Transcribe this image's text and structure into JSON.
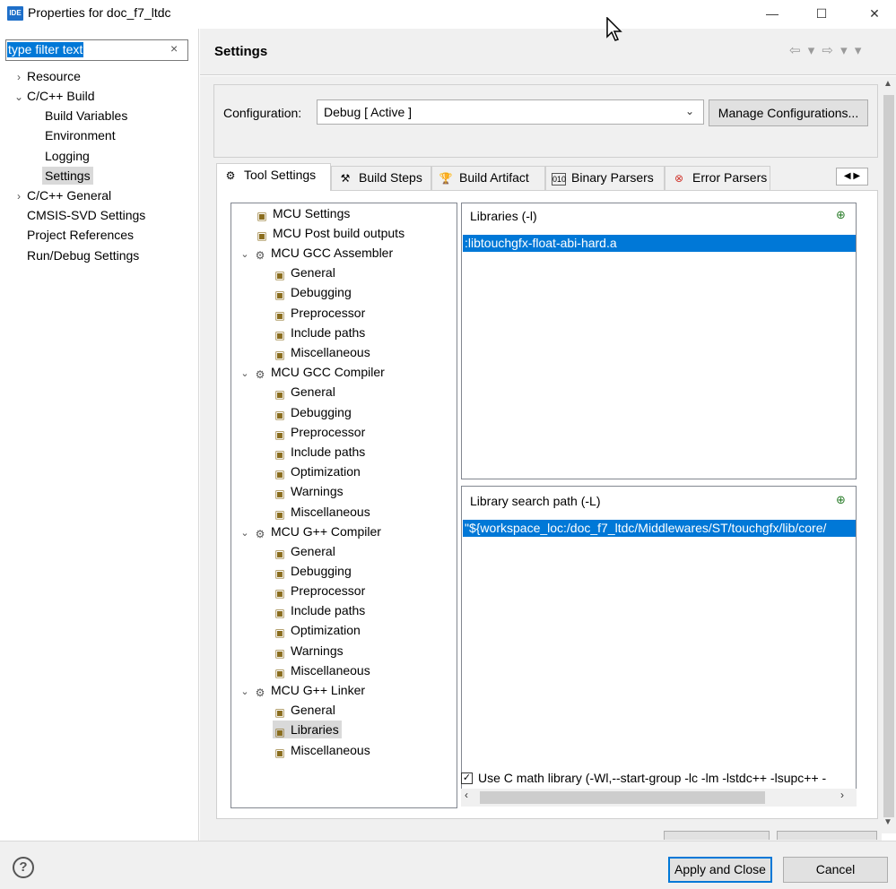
{
  "window": {
    "icon_text": "IDE",
    "title": "Properties for doc_f7_ltdc",
    "minimize": "—",
    "maximize": "☐",
    "close": "✕"
  },
  "filter": {
    "placeholder": "type filter text",
    "clear": "×"
  },
  "nav": [
    {
      "label": "Resource",
      "twisty": "›"
    },
    {
      "label": "C/C++ Build",
      "twisty": "⌄"
    },
    {
      "label": "Build Variables"
    },
    {
      "label": "Environment"
    },
    {
      "label": "Logging"
    },
    {
      "label": "Settings",
      "selected": true
    },
    {
      "label": "C/C++ General",
      "twisty": "›"
    },
    {
      "label": "CMSIS-SVD Settings"
    },
    {
      "label": "Project References"
    },
    {
      "label": "Run/Debug Settings"
    }
  ],
  "header": {
    "title": "Settings",
    "nav_arrows": "⇦ ▾ ⇨ ▾ ▾"
  },
  "configuration": {
    "label": "Configuration:",
    "value": "Debug  [ Active ]",
    "manage_button": "Manage Configurations..."
  },
  "tabs": [
    {
      "label": "Tool Settings",
      "icon": "gear-icon",
      "active": true
    },
    {
      "label": "Build Steps",
      "icon": "hammer-icon"
    },
    {
      "label": "Build Artifact",
      "icon": "trophy-icon"
    },
    {
      "label": "Binary Parsers",
      "icon": "binary-icon"
    },
    {
      "label": "Error Parsers",
      "icon": "error-icon"
    }
  ],
  "tree": [
    {
      "label": "MCU Settings",
      "level": 1
    },
    {
      "label": "MCU Post build outputs",
      "level": 1
    },
    {
      "label": "MCU GCC Assembler",
      "level": 0,
      "twisty": true
    },
    {
      "label": "General",
      "level": 2
    },
    {
      "label": "Debugging",
      "level": 2
    },
    {
      "label": "Preprocessor",
      "level": 2
    },
    {
      "label": "Include paths",
      "level": 2
    },
    {
      "label": "Miscellaneous",
      "level": 2
    },
    {
      "label": "MCU GCC Compiler",
      "level": 0,
      "twisty": true
    },
    {
      "label": "General",
      "level": 2
    },
    {
      "label": "Debugging",
      "level": 2
    },
    {
      "label": "Preprocessor",
      "level": 2
    },
    {
      "label": "Include paths",
      "level": 2
    },
    {
      "label": "Optimization",
      "level": 2
    },
    {
      "label": "Warnings",
      "level": 2
    },
    {
      "label": "Miscellaneous",
      "level": 2
    },
    {
      "label": "MCU G++ Compiler",
      "level": 0,
      "twisty": true
    },
    {
      "label": "General",
      "level": 2
    },
    {
      "label": "Debugging",
      "level": 2
    },
    {
      "label": "Preprocessor",
      "level": 2
    },
    {
      "label": "Include paths",
      "level": 2
    },
    {
      "label": "Optimization",
      "level": 2
    },
    {
      "label": "Warnings",
      "level": 2
    },
    {
      "label": "Miscellaneous",
      "level": 2
    },
    {
      "label": "MCU G++ Linker",
      "level": 0,
      "twisty": true
    },
    {
      "label": "General",
      "level": 2
    },
    {
      "label": "Libraries",
      "level": 2,
      "selected": true
    },
    {
      "label": "Miscellaneous",
      "level": 2
    }
  ],
  "libraries": {
    "title": "Libraries (-l)",
    "items": [
      ":libtouchgfx-float-abi-hard.a"
    ]
  },
  "library_search_path": {
    "title": "Library search path (-L)",
    "items": [
      "\"${workspace_loc:/doc_f7_ltdc/Middlewares/ST/touchgfx/lib/core/"
    ]
  },
  "math_option": {
    "checked": true,
    "label": "Use C math library (-Wl,--start-group -lc -lm -lstdc++ -lsupc++ -"
  },
  "footer": {
    "help": "?",
    "apply_close": "Apply and Close",
    "cancel": "Cancel"
  }
}
